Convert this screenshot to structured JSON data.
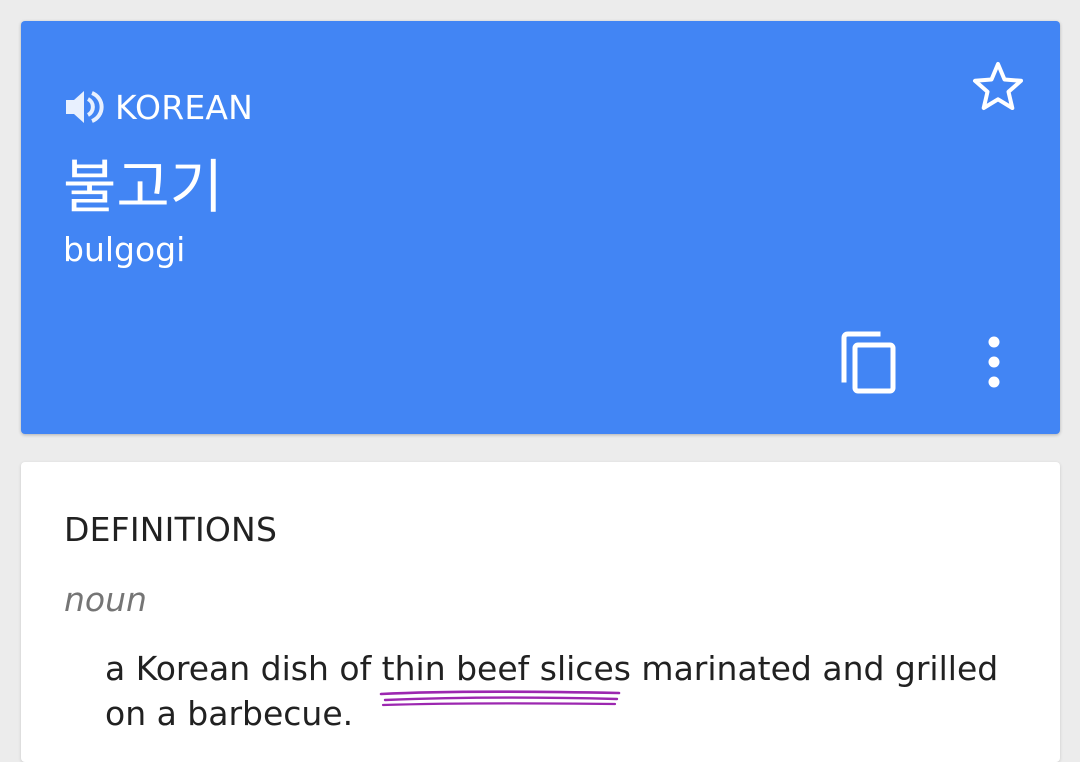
{
  "translation": {
    "language": "KOREAN",
    "source_text": "불고기",
    "romanization": "bulgogi",
    "icons": {
      "speaker": "speaker-icon",
      "star": "star-outline-icon",
      "copy": "copy-icon",
      "more": "more-vert-icon"
    }
  },
  "definitions": {
    "heading": "DEFINITIONS",
    "part_of_speech": "noun",
    "text": "a Korean dish of thin beef slices marinated and grilled on a barbecue."
  },
  "colors": {
    "card_blue": "#4285f4",
    "background": "#ececec",
    "annotation_purple": "#9c27b0"
  }
}
